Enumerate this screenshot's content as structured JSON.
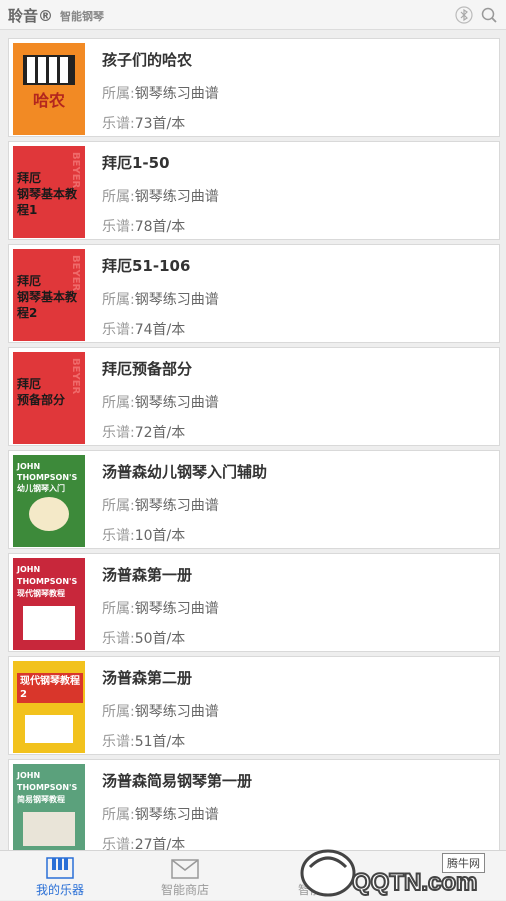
{
  "header": {
    "brand": "聆音®",
    "subtitle": "智能钢琴"
  },
  "items": [
    {
      "title": "孩子们的哈农",
      "cat_key": "所属:",
      "cat_val": "钢琴练习曲谱",
      "count_key": "乐谱:",
      "count_val": "73首/本",
      "cover_bg": "#f28a24",
      "cover_text": "哈农"
    },
    {
      "title": "拜厄1-50",
      "cat_key": "所属:",
      "cat_val": "钢琴练习曲谱",
      "count_key": "乐谱:",
      "count_val": "78首/本",
      "cover_bg": "#e0373a",
      "cover_text": "拜厄\n钢琴基本教程1"
    },
    {
      "title": "拜厄51-106",
      "cat_key": "所属:",
      "cat_val": "钢琴练习曲谱",
      "count_key": "乐谱:",
      "count_val": "74首/本",
      "cover_bg": "#e0373a",
      "cover_text": "拜厄\n钢琴基本教程2"
    },
    {
      "title": "拜厄预备部分",
      "cat_key": "所属:",
      "cat_val": "钢琴练习曲谱",
      "count_key": "乐谱:",
      "count_val": "72首/本",
      "cover_bg": "#e0373a",
      "cover_text": "拜厄\n预备部分"
    },
    {
      "title": "汤普森幼儿钢琴入门辅助",
      "cat_key": "所属:",
      "cat_val": "钢琴练习曲谱",
      "count_key": "乐谱:",
      "count_val": "10首/本",
      "cover_bg": "#3d8a3a",
      "cover_text": "JOHN THOMPSON'S\n幼儿钢琴入门"
    },
    {
      "title": "汤普森第一册",
      "cat_key": "所属:",
      "cat_val": "钢琴练习曲谱",
      "count_key": "乐谱:",
      "count_val": "50首/本",
      "cover_bg": "#c8273b",
      "cover_text": "JOHN THOMPSON'S\n现代钢琴教程"
    },
    {
      "title": "汤普森第二册",
      "cat_key": "所属:",
      "cat_val": "钢琴练习曲谱",
      "count_key": "乐谱:",
      "count_val": "51首/本",
      "cover_bg": "#f2c21d",
      "cover_text": "现代钢琴教程\n2"
    },
    {
      "title": "汤普森简易钢琴第一册",
      "cat_key": "所属:",
      "cat_val": "钢琴练习曲谱",
      "count_key": "乐谱:",
      "count_val": "27首/本",
      "cover_bg": "#5ba17c",
      "cover_text": "JOHN THOMPSON'S\n简易钢琴教程"
    }
  ],
  "tabs": [
    {
      "label": "我的乐器"
    },
    {
      "label": "智能商店"
    },
    {
      "label": "智能"
    }
  ],
  "watermark": {
    "site": "腾牛网",
    "brand": "QQTN.com"
  },
  "colors": {
    "accent": "#2a6fd6",
    "muted": "#999999"
  }
}
